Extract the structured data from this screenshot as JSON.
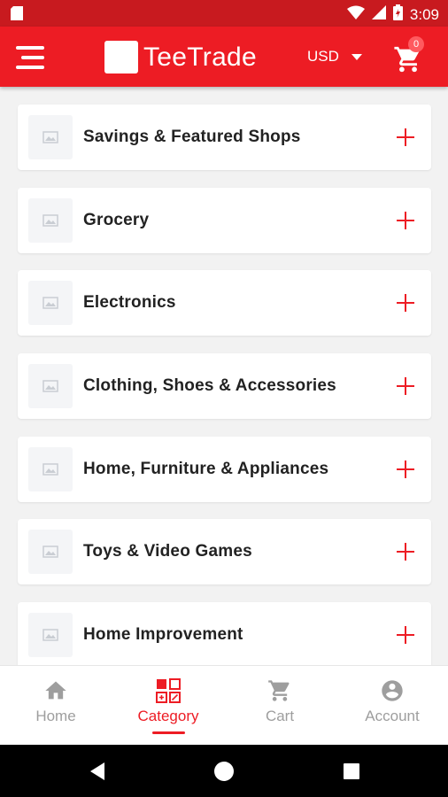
{
  "status_bar": {
    "time": "3:09"
  },
  "app_bar": {
    "app_name": "TeeTrade",
    "currency": "USD",
    "cart_count": "0"
  },
  "categories": [
    {
      "label": "Savings & Featured Shops"
    },
    {
      "label": "Grocery"
    },
    {
      "label": "Electronics"
    },
    {
      "label": "Clothing, Shoes & Accessories"
    },
    {
      "label": "Home, Furniture & Appliances"
    },
    {
      "label": "Toys & Video Games"
    },
    {
      "label": "Home Improvement"
    }
  ],
  "bottom_nav": {
    "items": [
      {
        "label": "Home",
        "icon": "home-icon"
      },
      {
        "label": "Category",
        "icon": "category-icon",
        "active": true
      },
      {
        "label": "Cart",
        "icon": "cart-icon"
      },
      {
        "label": "Account",
        "icon": "account-icon"
      }
    ]
  },
  "colors": {
    "brand_red": "#ed1c24",
    "status_bar": "#c81a1f",
    "inactive_nav": "#9e9e9e"
  }
}
